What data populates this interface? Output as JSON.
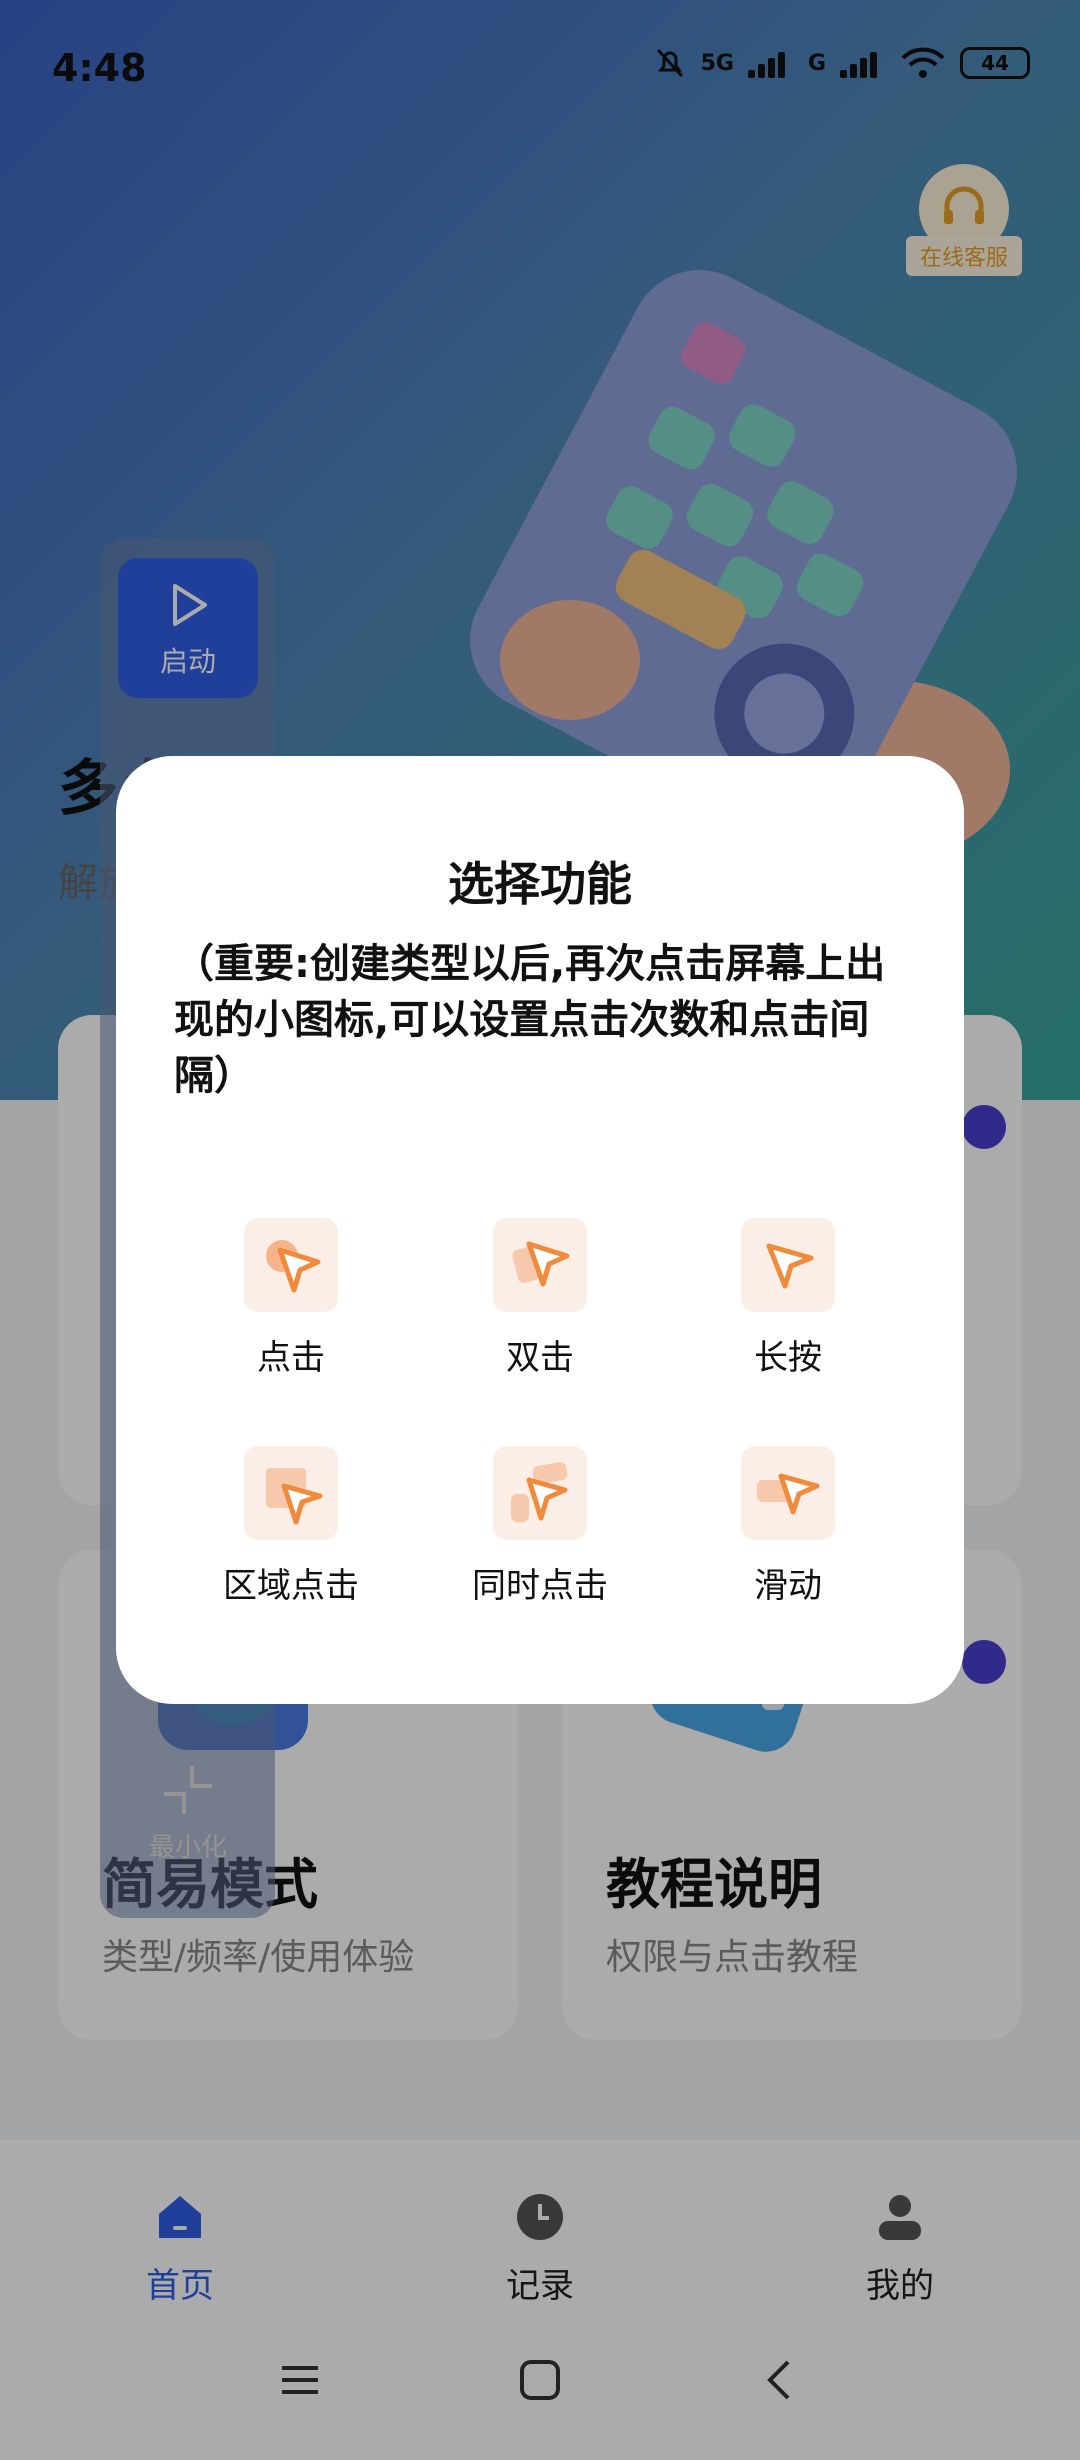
{
  "status": {
    "time": "4:48",
    "net1": "5G",
    "net2": "G",
    "battery": "44"
  },
  "service": {
    "label": "在线客服"
  },
  "app": {
    "title": "多点自动连点点击器",
    "subtitle": "解放双手"
  },
  "floating": {
    "start_label": "启动",
    "minimize_label": "最小化"
  },
  "cards": [
    {
      "title": "简易模式",
      "subtitle": "类型/频率/使用体验"
    },
    {
      "title": "教程说明",
      "subtitle": "权限与点击教程"
    }
  ],
  "tabs": [
    {
      "label": "首页"
    },
    {
      "label": "记录"
    },
    {
      "label": "我的"
    }
  ],
  "dialog": {
    "title": "选择功能",
    "note": "（重要:创建类型以后,再次点击屏幕上出现的小图标,可以设置点击次数和点击间隔）",
    "options": [
      {
        "label": "点击"
      },
      {
        "label": "双击"
      },
      {
        "label": "长按"
      },
      {
        "label": "区域点击"
      },
      {
        "label": "同时点击"
      },
      {
        "label": "滑动"
      }
    ]
  },
  "colors": {
    "accent": "#2f5fe8",
    "icon_orange": "#f08a3c",
    "icon_bg": "#fbeee6",
    "service": "#e6a126"
  }
}
